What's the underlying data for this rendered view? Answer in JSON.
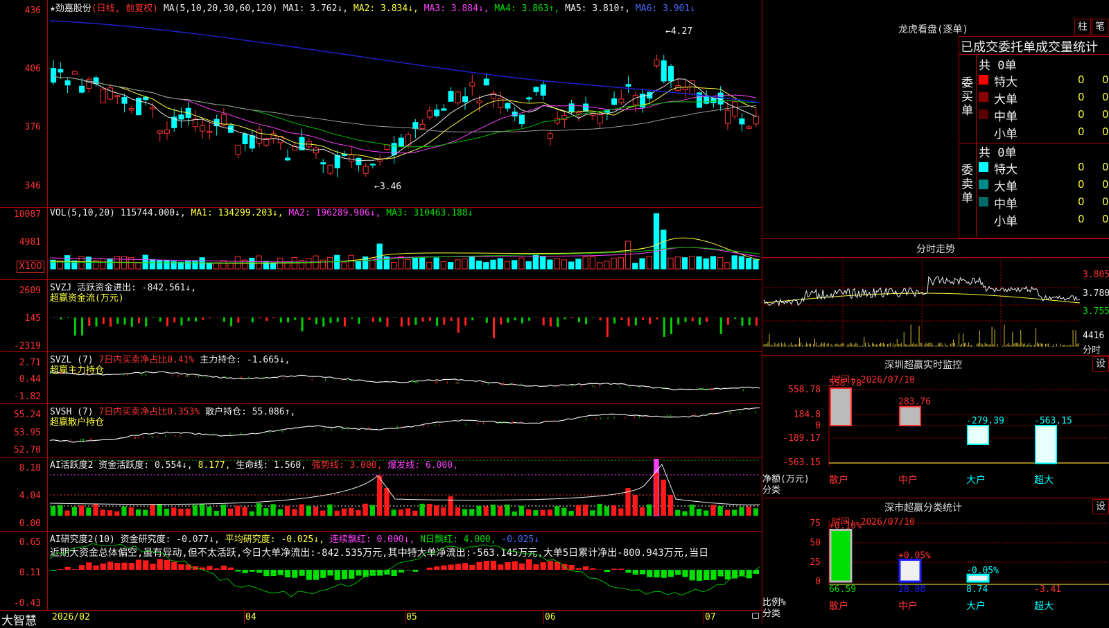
{
  "header": {
    "stock_name": "★劲嘉股份",
    "mode": "(日线, 前复权)",
    "ma_prefix": "MA(5,10,20,30,60,120)",
    "ma1": "MA1: 3.762↓,",
    "ma2": "MA2: 3.834↓,",
    "ma3": "MA3: 3.884↓,",
    "ma4": "MA4: 3.863↑,",
    "ma5": "MA5: 3.810↑,",
    "ma6": "MA6: 3.901↓"
  },
  "price_axis": {
    "ticks": [
      "436",
      "406",
      "376",
      "346"
    ]
  },
  "price_notes": {
    "high": "4.27",
    "low": "3.46"
  },
  "vol": {
    "label": "VOL(5,10,20)",
    "v": "115744.000↓,",
    "ma1": "MA1: 134299.203↓,",
    "ma2": "MA2: 196289.906↓,",
    "ma3": "MA3: 310463.188↓",
    "ticks": [
      "10087",
      "4981"
    ],
    "unit": "X100"
  },
  "svzj": {
    "label": "SVZJ  活跃资金进出: -842.561↓,",
    "sub": "超赢资金流(万元)",
    "ticks": [
      "2609",
      "145",
      "-2319"
    ]
  },
  "svzl": {
    "label": "SVZL (7)",
    "l2": "7日内买卖净占比0.41%",
    "l3": "主力持仓: -1.665↓,",
    "sub": "超赢主力持仓",
    "ticks": [
      "2.71",
      "0.44",
      "-1.82"
    ]
  },
  "svsh": {
    "label": "SVSH (7)",
    "l2": "7日内买卖净占比0.353%",
    "l3": "散户持仓: 55.086↑,",
    "sub": "超赢散户持仓",
    "ticks": [
      "55.24",
      "53.95",
      "52.70"
    ]
  },
  "ai1": {
    "label": "AI活跃度2",
    "l2": "资金活跃度: 0.554↓,",
    "l3": "8.177,",
    "l4": "生命线: 1.560,",
    "l5": "强势线: 3.000,",
    "l6": "爆发线: 6.000,",
    "ticks": [
      "8.18",
      "4.04",
      "0.00"
    ]
  },
  "ai2": {
    "label": "AI研究度2(10)",
    "l2": "资金研究度: -0.077↓,",
    "l3": "平均研究度: -0.025↓,",
    "l4": "连续飘红: 0.000↓,",
    "l5": "N日飘红: 4.000,",
    "l6": "-0.025↓",
    "desc": "近期大资金总体偏空,虽有异动,但不太活跃,今日大单净流出:-842.535万元,其中特大单净流出:-563.145万元,大单5日累计净出-800.943万元,当日",
    "ticks": [
      "0.65",
      "0.11",
      "-0.43"
    ]
  },
  "footer": {
    "app": "大智慧",
    "dates": [
      "2026/02",
      "04",
      "05",
      "06",
      "07"
    ]
  },
  "dragon": {
    "title": "龙虎看盘(逐单)",
    "btn1": "柱",
    "btn2": "笔",
    "subtitle": "已成交委托单成交量统计",
    "buy_label": "委买单",
    "sell_label": "委卖单",
    "buy_total": "共 0单",
    "sell_total": "共 0单",
    "buy_rows": [
      {
        "name": "特大",
        "count": "0",
        "pct": "0%",
        "color": "#ff0000"
      },
      {
        "name": "大单",
        "count": "0",
        "pct": "0%",
        "color": "#8b0000"
      },
      {
        "name": "中单",
        "count": "0",
        "pct": "0%",
        "color": "#5a0000"
      },
      {
        "name": "小单",
        "count": "0",
        "pct": "0%",
        "color": ""
      }
    ],
    "sell_rows": [
      {
        "name": "特大",
        "count": "0",
        "pct": "0%",
        "color": "#00ffff"
      },
      {
        "name": "大单",
        "count": "0",
        "pct": "0%",
        "color": "#008b8b"
      },
      {
        "name": "中单",
        "count": "0",
        "pct": "0%",
        "color": "#006a6a"
      },
      {
        "name": "小单",
        "count": "0",
        "pct": "0%",
        "color": ""
      }
    ]
  },
  "intraday": {
    "title": "分时走势",
    "ticks": [
      "3.805",
      "3.780",
      "3.755"
    ],
    "vol_tick": "4416",
    "vol_unit": "分时"
  },
  "monitor": {
    "title": "深圳超赢实时监控",
    "btn": "设",
    "time": "时间: 2026/07/10",
    "ticks": [
      "558.78",
      "184.8",
      "0",
      "-189.17",
      "-563.15"
    ],
    "axis_label": "净额(万元)",
    "axis_label2": "分类",
    "categories": [
      "散户",
      "中户",
      "大户",
      "超大"
    ],
    "values": [
      558.78,
      283.76,
      -279.39,
      -563.15
    ],
    "value_labels": [
      "558.78",
      "283.76",
      "-279.39",
      "-563.15"
    ]
  },
  "classify": {
    "title": "深市超赢分类统计",
    "btn": "设",
    "time": "时间: 2026/07/10",
    "ticks": [
      "75",
      "50",
      "25",
      "0"
    ],
    "axis_label": "比例%",
    "axis_label2": "分类",
    "categories": [
      "散户",
      "中户",
      "大户",
      "超大"
    ],
    "values": [
      66.59,
      28.08,
      8.74,
      -3.41
    ],
    "value_labels": [
      "66.59",
      "28.08",
      "8.74",
      "-3.41"
    ],
    "change_labels": [
      "+0.10%",
      "+0.05%",
      "-0.05%",
      ""
    ]
  },
  "colors": {
    "up": "#ff3232",
    "down": "#00ffff",
    "grid": "#b00000",
    "ma_yellow": "#ffff40",
    "ma_magenta": "#ff40ff",
    "ma_blue": "#2020d0",
    "ma_green": "#00c000",
    "ma_white": "#e8e8e8"
  }
}
